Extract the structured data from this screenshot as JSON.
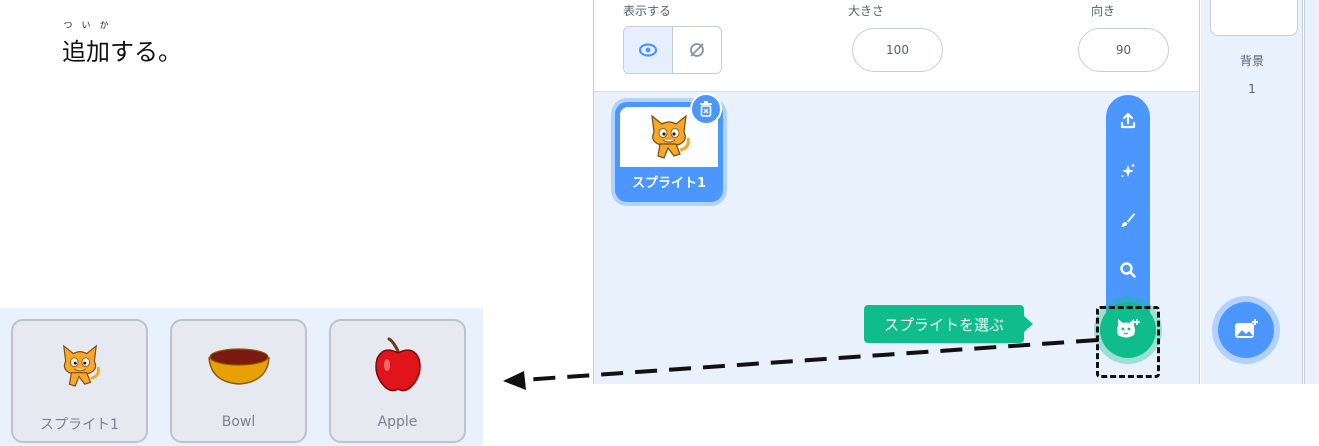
{
  "instruction": {
    "ruby": [
      "つ",
      "い",
      "か"
    ],
    "text": "追加する。"
  },
  "sprite_info": {
    "show_label": "表示する",
    "size_label": "大きさ",
    "direction_label": "向き",
    "size_value": "100",
    "direction_value": "90"
  },
  "sprites": [
    {
      "name": "スプライト1",
      "selected": true
    }
  ],
  "sprite_menu": {
    "items": [
      "upload-icon",
      "surprise-icon",
      "paint-icon",
      "search-icon"
    ],
    "tooltip": "スプライトを選ぶ",
    "choose_icon": "cat-plus-icon"
  },
  "stage": {
    "backdrop_label": "背景",
    "backdrop_count": "1",
    "choose_icon": "image-plus-icon"
  },
  "library": {
    "items": [
      {
        "name": "スプライト1",
        "icon": "cat-icon"
      },
      {
        "name": "Bowl",
        "icon": "bowl-icon"
      },
      {
        "name": "Apple",
        "icon": "apple-icon"
      }
    ]
  },
  "colors": {
    "accent": "#4c97ff",
    "choose_green": "#0fbd8c",
    "panel_bg": "#e9f1fc",
    "text": "#575e75"
  }
}
